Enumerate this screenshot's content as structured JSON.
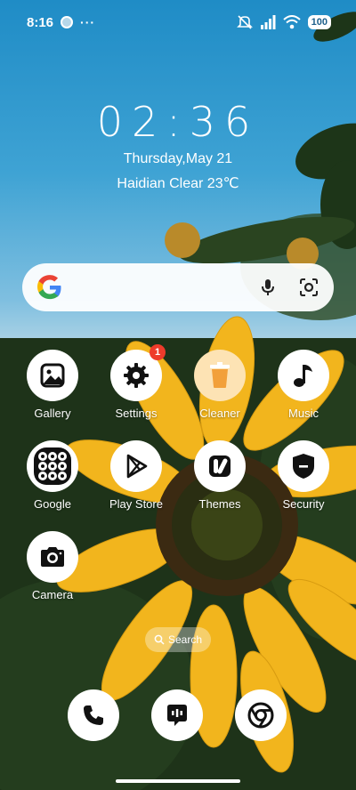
{
  "status_bar": {
    "time": "8:16",
    "more": "···",
    "battery": "100"
  },
  "clock": {
    "time": "02:36",
    "date": "Thursday,May 21",
    "weather": "Haidian Clear 23℃"
  },
  "search_bar": {
    "icons": [
      "google-logo-icon",
      "mic-icon",
      "lens-icon"
    ]
  },
  "apps": [
    {
      "label": "Gallery",
      "icon": "gallery-icon"
    },
    {
      "label": "Settings",
      "icon": "gear-icon",
      "badge": "1"
    },
    {
      "label": "Cleaner",
      "icon": "trash-icon"
    },
    {
      "label": "Music",
      "icon": "music-note-icon"
    },
    {
      "label": "Google",
      "icon": "google-folder-icon"
    },
    {
      "label": "Play Store",
      "icon": "play-store-icon"
    },
    {
      "label": "Themes",
      "icon": "themes-icon"
    },
    {
      "label": "Security",
      "icon": "shield-icon"
    },
    {
      "label": "Camera",
      "icon": "camera-icon"
    }
  ],
  "search_pill": {
    "label": "Search"
  },
  "dock": [
    {
      "icon": "phone-icon"
    },
    {
      "icon": "messages-icon"
    },
    {
      "icon": "chrome-icon"
    }
  ],
  "colors": {
    "badge": "#ee3b2b",
    "cleaner_bg": "#fde3b4",
    "sunflower": "#f2b51d"
  }
}
